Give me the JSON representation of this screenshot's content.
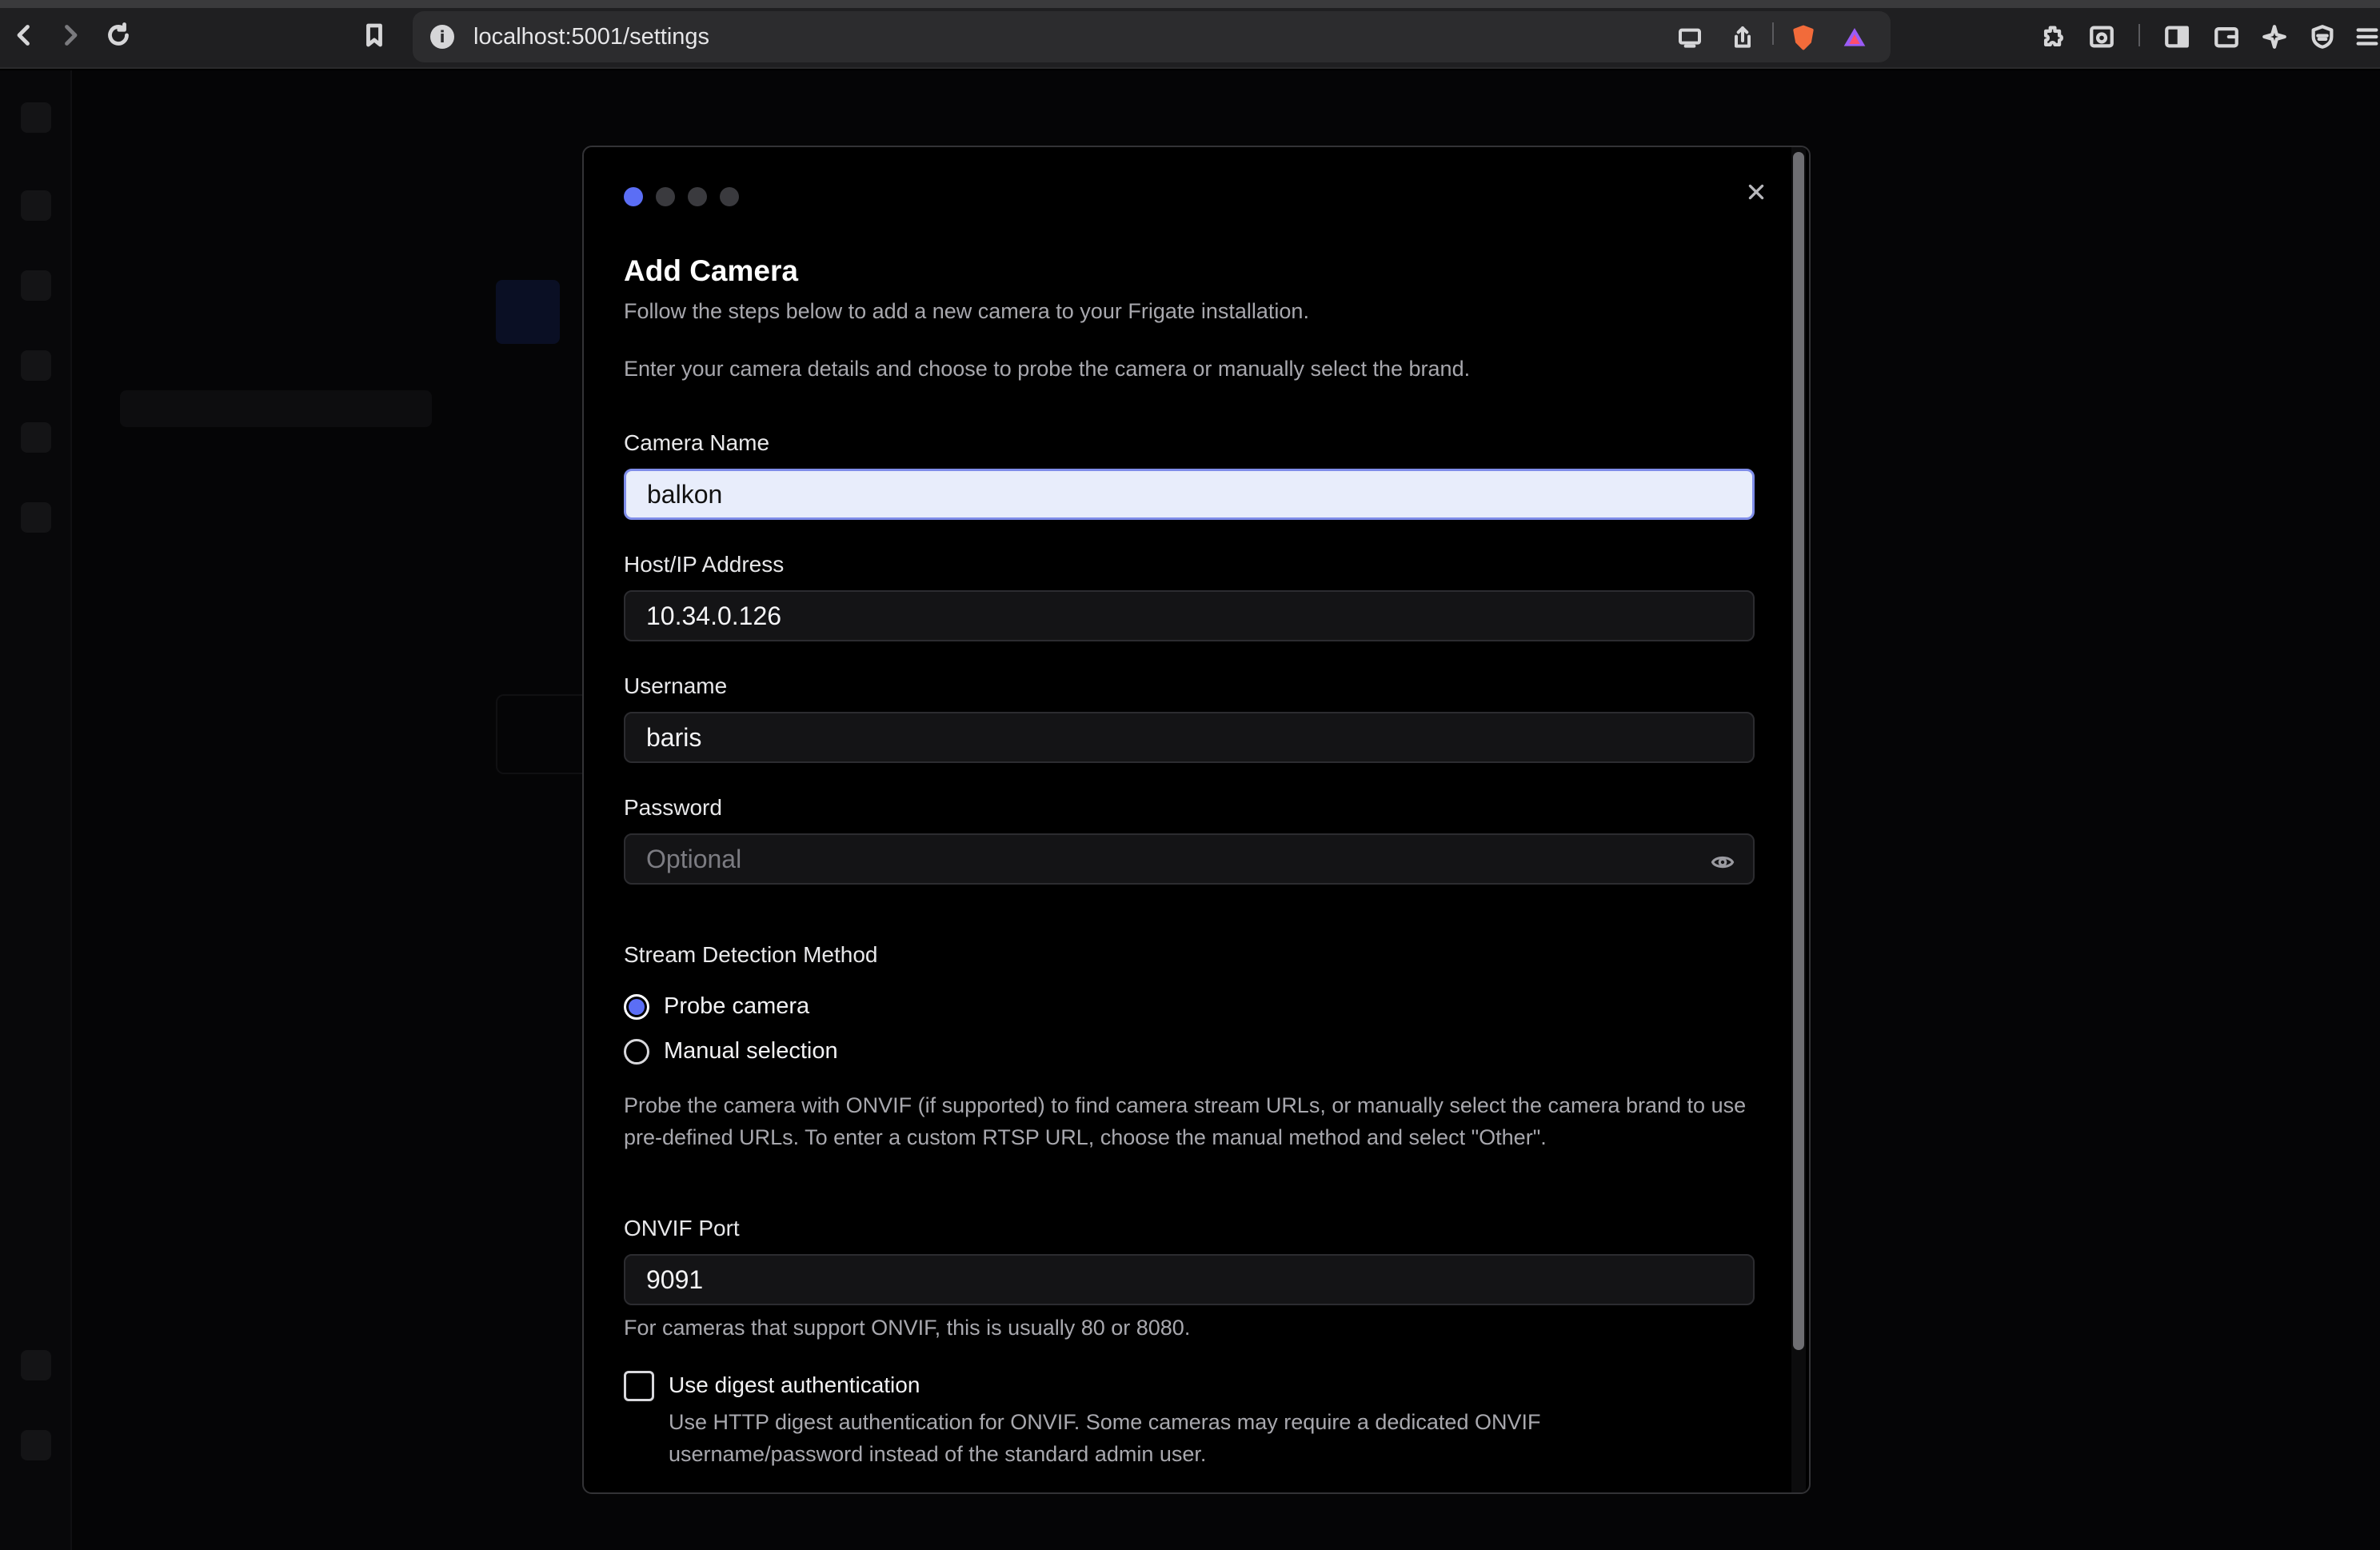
{
  "browser": {
    "url": "localhost:5001/settings"
  },
  "modal": {
    "steps": [
      true,
      false,
      false,
      false
    ],
    "title": "Add Camera",
    "subtitle": "Follow the steps below to add a new camera to your Frigate installation.",
    "description": "Enter your camera details and choose to probe the camera or manually select the brand.",
    "fields": {
      "camera_name": {
        "label": "Camera Name",
        "value": "balkon"
      },
      "host": {
        "label": "Host/IP Address",
        "value": "10.34.0.126"
      },
      "username": {
        "label": "Username",
        "value": "baris"
      },
      "password": {
        "label": "Password",
        "placeholder": "Optional"
      }
    },
    "stream_detection": {
      "label": "Stream Detection Method",
      "options": [
        {
          "label": "Probe camera",
          "selected": true
        },
        {
          "label": "Manual selection",
          "selected": false
        }
      ],
      "help": "Probe the camera with ONVIF (if supported) to find camera stream URLs, or manually select the camera brand to use pre-defined URLs. To enter a custom RTSP URL, choose the manual method and select \"Other\"."
    },
    "onvif_port": {
      "label": "ONVIF Port",
      "value": "9091",
      "help": "For cameras that support ONVIF, this is usually 80 or 8080."
    },
    "digest_auth": {
      "label": "Use digest authentication",
      "checked": false,
      "help": "Use HTTP digest authentication for ONVIF. Some cameras may require a dedicated ONVIF username/password instead of the standard admin user."
    }
  },
  "colors": {
    "accent": "#5b6ef5",
    "modal_bg": "#000000",
    "input_bg": "#141416",
    "focused_input_bg": "#e8edfb"
  }
}
